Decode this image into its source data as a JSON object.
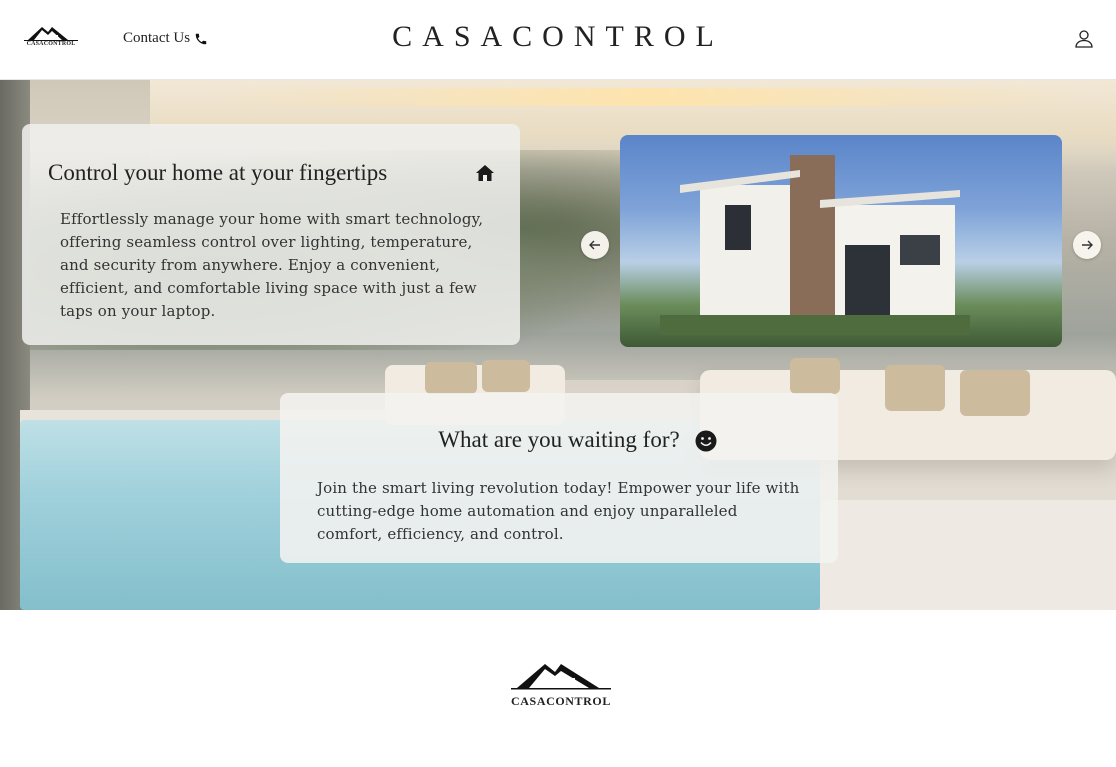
{
  "header": {
    "logo_text": "CASACONTROL",
    "contact_label": "Contact Us",
    "brand": "CASACONTROL"
  },
  "hero": {
    "card1": {
      "title": "Control your home at your fingertips",
      "body": "Effortlessly manage your home with smart technology, offering seamless control over lighting, temperature, and security from anywhere. Enjoy a convenient, efficient, and comfortable living space with just a few taps on your laptop."
    },
    "card2": {
      "title": "What are you waiting for?",
      "body": "Join the smart living revolution today! Empower your life with cutting-edge home automation and enjoy unparalleled comfort, efficiency, and control."
    }
  },
  "footer": {
    "logo_text": "CASACONTROL"
  },
  "icons": {
    "phone": "phone-icon",
    "account": "user-icon",
    "home": "home-icon",
    "smile": "smile-icon",
    "prev": "arrow-left-icon",
    "next": "arrow-right-icon"
  }
}
